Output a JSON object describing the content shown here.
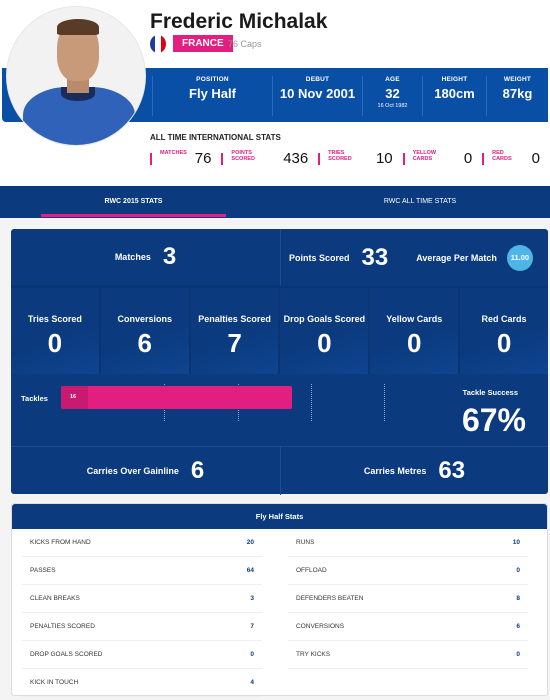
{
  "player": {
    "name": "Frederic Michalak",
    "country": "FRANCE",
    "caps": "76 Caps",
    "flag_colors": [
      "#1c3f95",
      "#ffffff",
      "#e1000f"
    ]
  },
  "info": [
    {
      "label": "POSITION",
      "value": "Fly Half"
    },
    {
      "label": "DEBUT",
      "value": "10 Nov 2001"
    },
    {
      "label": "AGE",
      "value": "32",
      "sub": "16 Oct 1982"
    },
    {
      "label": "HEIGHT",
      "value": "180cm"
    },
    {
      "label": "WEIGHT",
      "value": "87kg"
    }
  ],
  "all_time": {
    "title": "ALL TIME INTERNATIONAL STATS",
    "items": [
      {
        "label": "MATCHES",
        "value": "76"
      },
      {
        "label": "POINTS SCORED",
        "value": "436"
      },
      {
        "label": "TRIES SCORED",
        "value": "10"
      },
      {
        "label": "YELLOW CARDS",
        "value": "0"
      },
      {
        "label": "RED CARDS",
        "value": "0"
      }
    ]
  },
  "tabs": [
    {
      "label": "RWC 2015 STATS",
      "active": true
    },
    {
      "label": "RWC ALL TIME STATS",
      "active": false
    }
  ],
  "rwc": {
    "matches": {
      "label": "Matches",
      "value": "3"
    },
    "points": {
      "label": "Points Scored",
      "value": "33"
    },
    "average": {
      "label": "Average Per Match",
      "value": "11.00"
    },
    "tiles": [
      {
        "label": "Tries Scored",
        "value": "0"
      },
      {
        "label": "Conversions",
        "value": "6"
      },
      {
        "label": "Penalties Scored",
        "value": "7"
      },
      {
        "label": "Drop Goals Scored",
        "value": "0"
      },
      {
        "label": "Yellow Cards",
        "value": "0"
      },
      {
        "label": "Red Cards",
        "value": "0"
      }
    ],
    "tackles": {
      "label": "Tackles",
      "made": "16",
      "success_label": "Tackle Success",
      "success_value": "67%",
      "success_fraction": 0.67
    },
    "carries_over": {
      "label": "Carries Over Gainline",
      "value": "6"
    },
    "carries_metres": {
      "label": "Carries Metres",
      "value": "63"
    }
  },
  "fly_half": {
    "title": "Fly Half Stats",
    "left": [
      {
        "label": "KICKS FROM HAND",
        "value": "20"
      },
      {
        "label": "PASSES",
        "value": "64"
      },
      {
        "label": "CLEAN BREAKS",
        "value": "3"
      },
      {
        "label": "PENALTIES SCORED",
        "value": "7"
      },
      {
        "label": "DROP GOALS SCORED",
        "value": "0"
      },
      {
        "label": "KICK IN TOUCH",
        "value": "4"
      }
    ],
    "right": [
      {
        "label": "RUNS",
        "value": "10"
      },
      {
        "label": "OFFLOAD",
        "value": "0"
      },
      {
        "label": "DEFENDERS BEATEN",
        "value": "8"
      },
      {
        "label": "CONVERSIONS",
        "value": "6"
      },
      {
        "label": "TRY KICKS",
        "value": "0"
      }
    ]
  }
}
